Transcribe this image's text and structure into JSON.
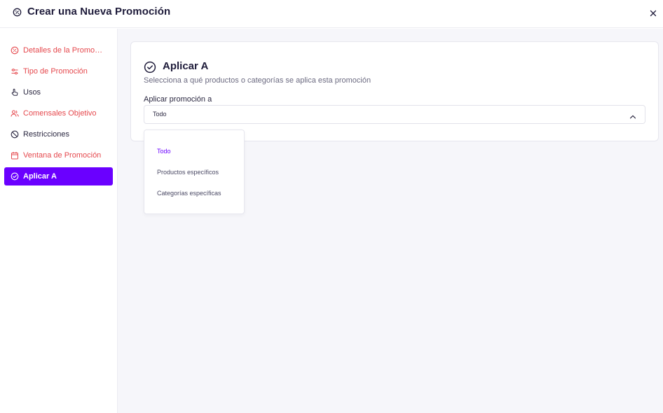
{
  "header": {
    "title": "Crear una Nueva Promoción"
  },
  "sidebar": {
    "items": [
      {
        "label": "Detalles de la Promoción",
        "icon": "percent-badge-icon",
        "state": "red"
      },
      {
        "label": "Tipo de Promoción",
        "icon": "sliders-icon",
        "state": "red"
      },
      {
        "label": "Usos",
        "icon": "pointer-hand-icon",
        "state": "dark"
      },
      {
        "label": "Comensales Objetivo",
        "icon": "users-icon",
        "state": "red"
      },
      {
        "label": "Restricciones",
        "icon": "ban-icon",
        "state": "dark"
      },
      {
        "label": "Ventana de Promoción",
        "icon": "calendar-icon",
        "state": "red"
      },
      {
        "label": "Aplicar A",
        "icon": "check-circle-icon",
        "state": "active"
      }
    ]
  },
  "main": {
    "card": {
      "title": "Aplicar A",
      "subtitle": "Selecciona a qué productos o categorías se aplica esta promoción",
      "field_label": "Aplicar promoción a",
      "select_value": "Todo"
    },
    "dropdown": {
      "options": [
        "Todo",
        "Productos específicos",
        "Categorías específicas"
      ],
      "selected": "Todo"
    }
  },
  "colors": {
    "accent": "#6a00ff",
    "error": "#e5484d",
    "text": "#1e1b3a",
    "muted": "#6b6a80",
    "background": "#f6f6fa"
  }
}
